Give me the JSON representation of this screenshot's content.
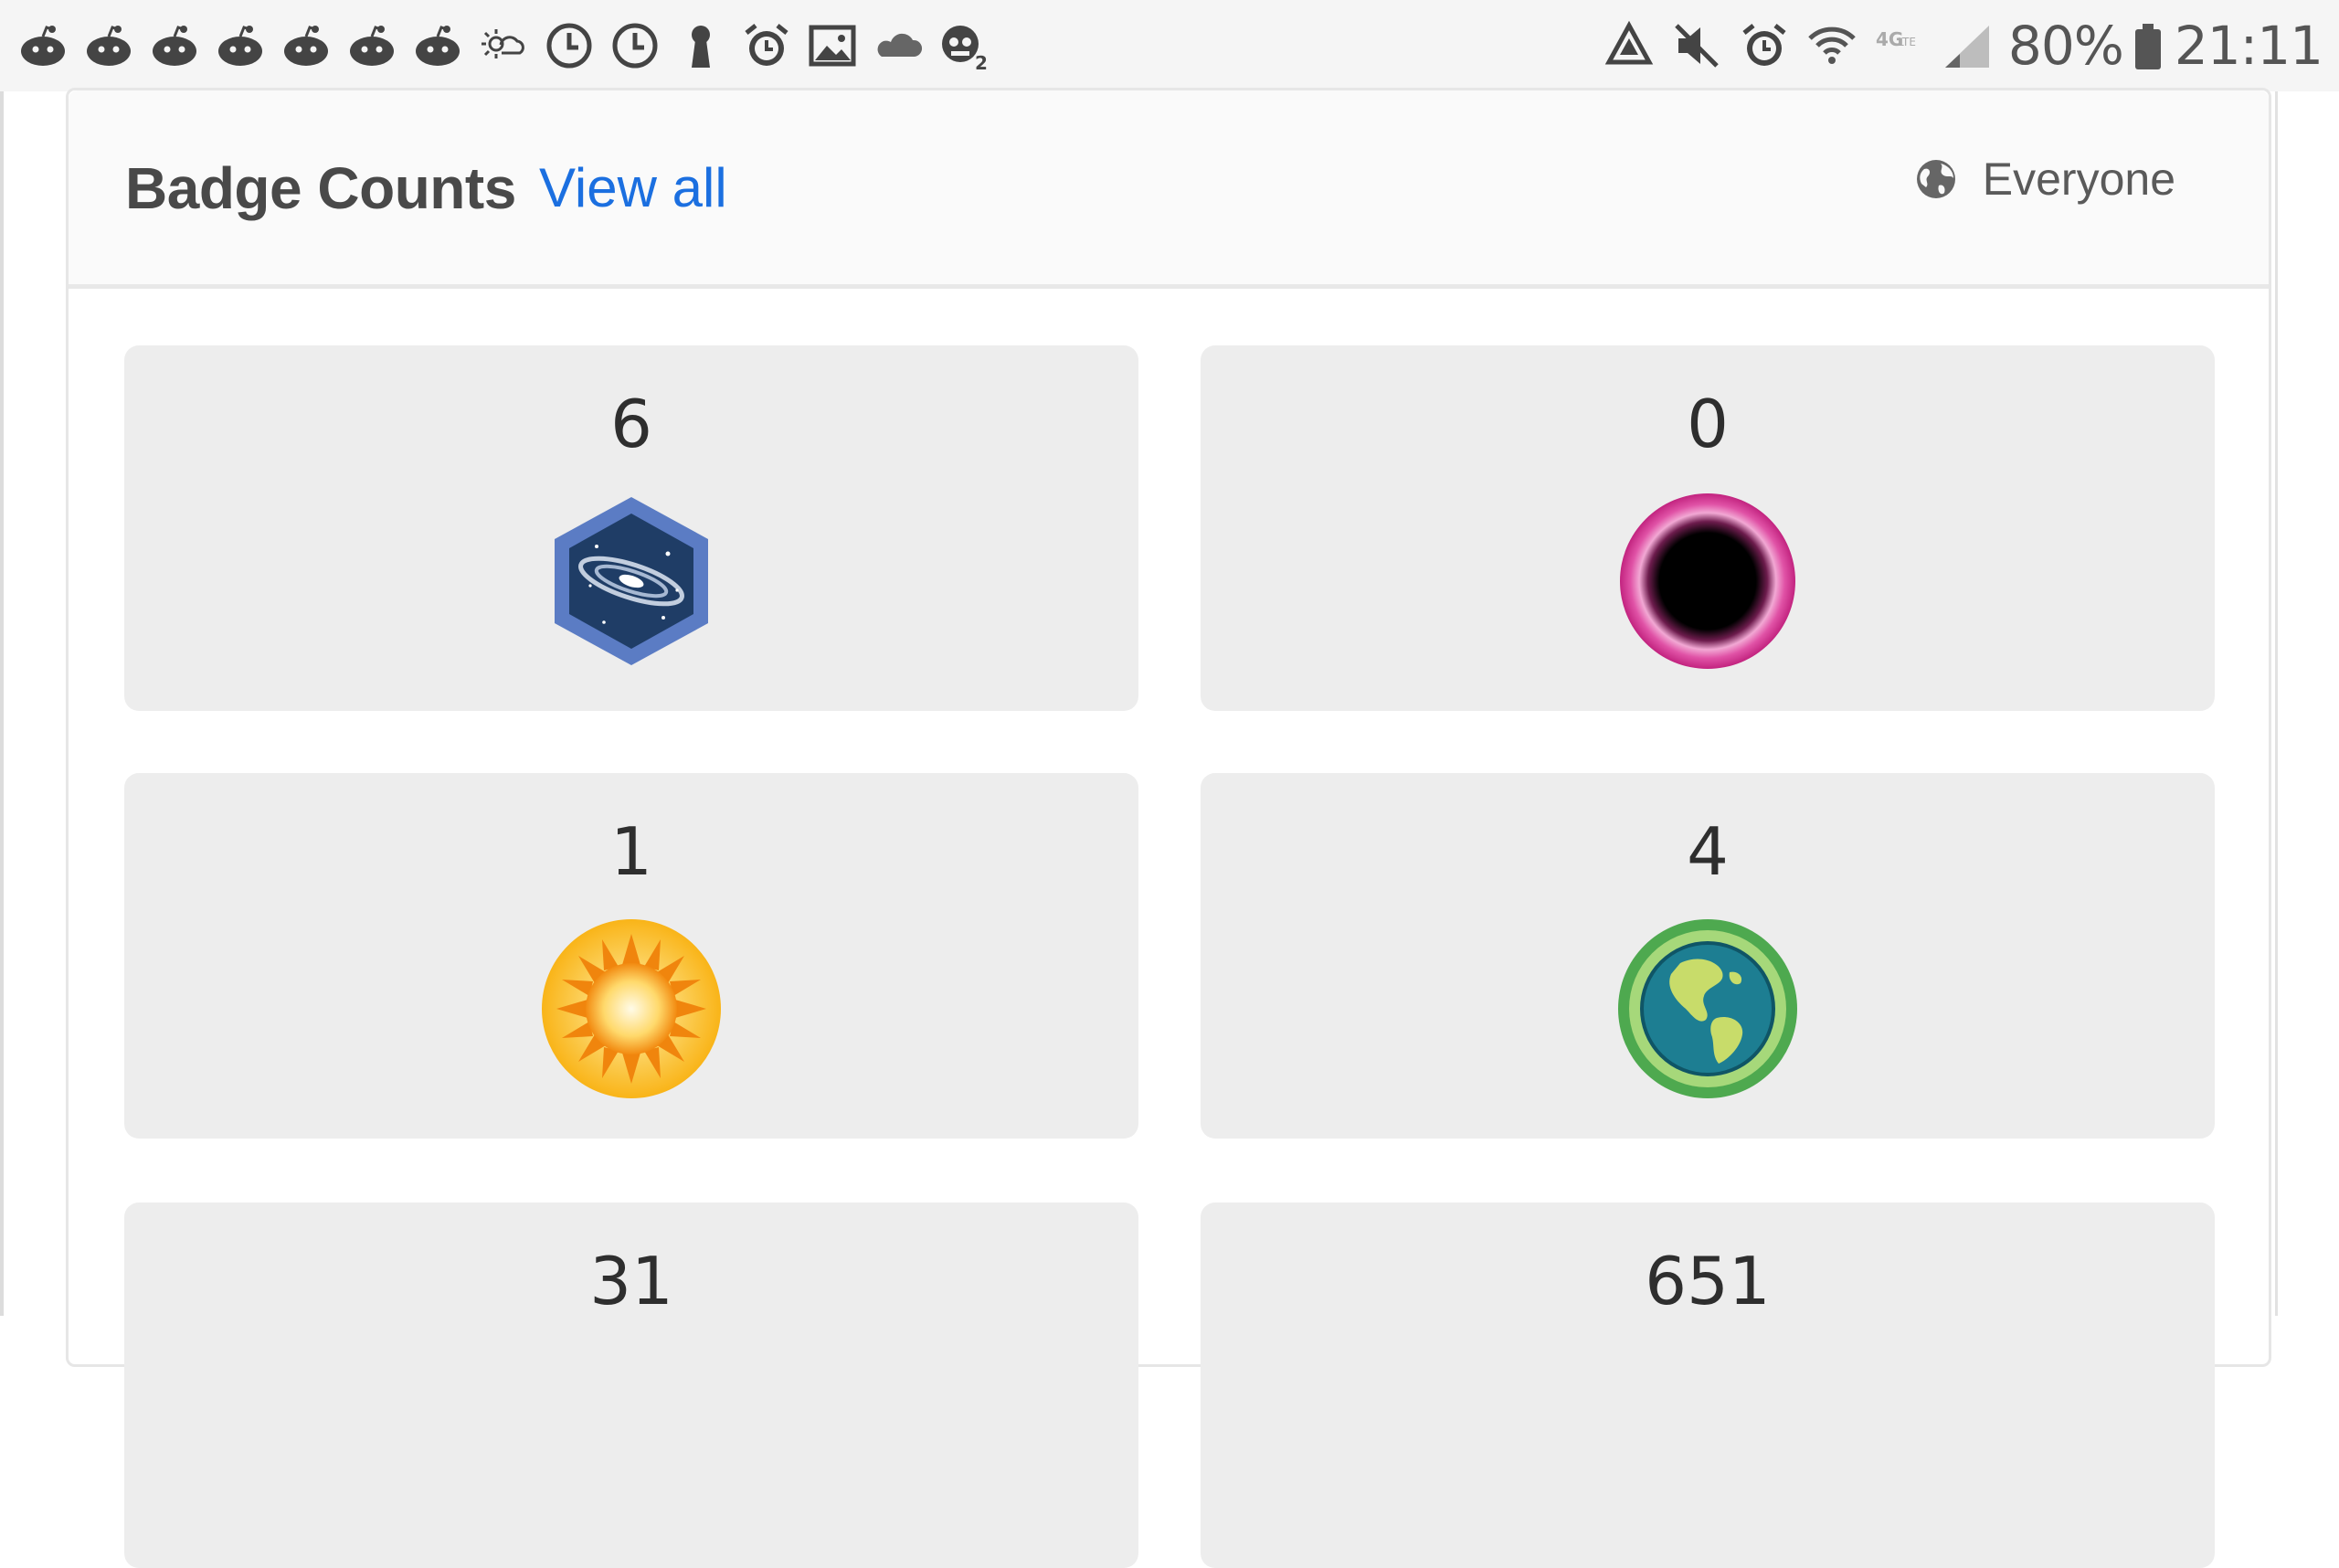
{
  "status_bar": {
    "left_icons": [
      "reddit-icon",
      "reddit-icon",
      "reddit-icon",
      "reddit-icon",
      "reddit-icon",
      "reddit-icon",
      "reddit-icon",
      "weather-icon",
      "clock-icon",
      "clock-icon",
      "keyhole-icon",
      "alarm-icon",
      "image-icon",
      "cloud-icon",
      "robot-face-icon"
    ],
    "right_icons": [
      "recycle-icon",
      "mute-icon",
      "alarm-icon",
      "wifi-icon",
      "lte-icon",
      "signal-icon"
    ],
    "battery_percent": "80%",
    "time": "21:11"
  },
  "card": {
    "title": "Badge Counts",
    "view_all_label": "View all",
    "audience_label": "Everyone"
  },
  "badges": [
    {
      "count": "6",
      "icon": "galaxy-badge-icon",
      "color": "#4a6fb5"
    },
    {
      "count": "0",
      "icon": "black-hole-badge-icon",
      "color": "#d0388f"
    },
    {
      "count": "1",
      "icon": "sun-badge-icon",
      "color": "#f7b21e"
    },
    {
      "count": "4",
      "icon": "earth-badge-icon",
      "color": "#4daa4f"
    },
    {
      "count": "31",
      "icon": "",
      "color": ""
    },
    {
      "count": "651",
      "icon": "",
      "color": ""
    }
  ],
  "colors": {
    "accent_link": "#1b6fe0",
    "tile_background": "#ededed",
    "status_bar_background": "#f5f5f5"
  }
}
